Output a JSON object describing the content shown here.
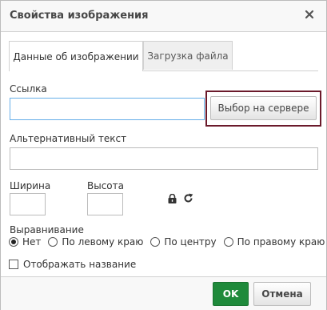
{
  "dialog": {
    "title": "Свойства изображения",
    "close_icon": "close-icon"
  },
  "tabs": [
    {
      "label": "Данные об изображении",
      "active": true
    },
    {
      "label": "Загрузка файла",
      "active": false
    }
  ],
  "url_field": {
    "label": "Ссылка",
    "value": "",
    "browse_button_label": "Выбор на сервере"
  },
  "alt_field": {
    "label": "Альтернативный текст",
    "value": ""
  },
  "size": {
    "width_label": "Ширина",
    "width_value": "",
    "height_label": "Высота",
    "height_value": "",
    "lock_icon": "lock-icon",
    "reset_icon": "reset-icon"
  },
  "alignment": {
    "label": "Выравнивание",
    "options": [
      {
        "label": "Нет",
        "selected": true
      },
      {
        "label": "По левому краю",
        "selected": false
      },
      {
        "label": "По центру",
        "selected": false
      },
      {
        "label": "По правому краю",
        "selected": false
      }
    ]
  },
  "caption": {
    "label": "Отображать название",
    "checked": false
  },
  "footer": {
    "ok_label": "OK",
    "cancel_label": "Отмена"
  },
  "colors": {
    "accent_ok": "#1f8a3b",
    "highlight_border": "#6b1a2b",
    "focus_border": "#66afe9"
  }
}
